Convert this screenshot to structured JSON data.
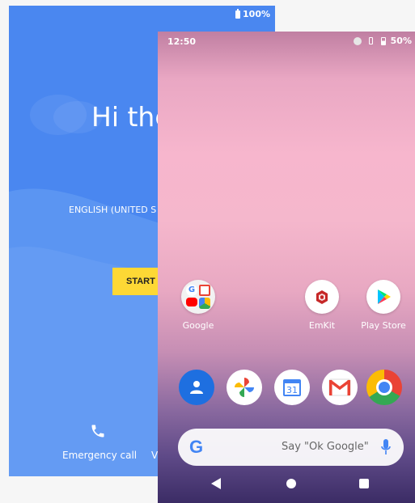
{
  "setup": {
    "battery_level": "100%",
    "greeting": "Hi the",
    "language": "ENGLISH (UNITED S",
    "start_label": "START",
    "emergency_label": "Emergency call",
    "vision_label": "V"
  },
  "home": {
    "status": {
      "time": "12:50",
      "battery_level": "50%"
    },
    "apps": [
      {
        "label": "Google",
        "icon": "google-folder-icon"
      },
      {
        "label": "EmKit",
        "icon": "emkit-icon"
      },
      {
        "label": "Play Store",
        "icon": "play-store-icon"
      }
    ],
    "dock": [
      "contacts-icon",
      "photos-icon",
      "calendar-icon",
      "gmail-icon",
      "chrome-icon"
    ],
    "calendar_day": "31",
    "search": {
      "logo": "G",
      "hint": "Say \"Ok Google\""
    }
  },
  "colors": {
    "setup_blue": "#4a87f0",
    "start_yellow": "#fdd835"
  }
}
